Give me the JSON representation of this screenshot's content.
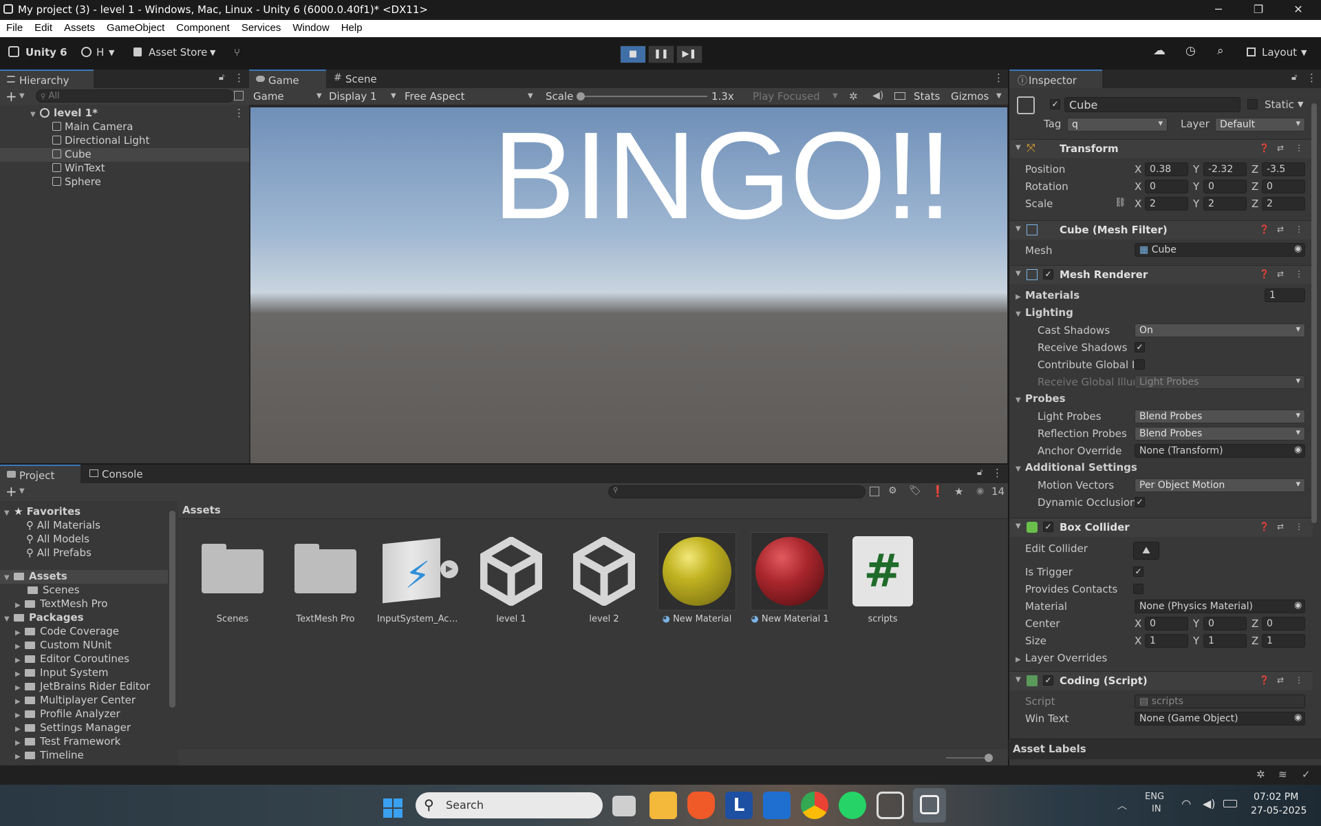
{
  "window": {
    "title": "My project (3) - level 1 - Windows, Mac, Linux - Unity 6 (6000.0.40f1)* <DX11>",
    "minimize": "─",
    "restore": "❐",
    "close": "✕"
  },
  "menu": [
    "File",
    "Edit",
    "Assets",
    "GameObject",
    "Component",
    "Services",
    "Window",
    "Help"
  ],
  "toolbar": {
    "unity_label": "Unity 6",
    "account": "H",
    "asset_store": "Asset Store",
    "layout": "Layout"
  },
  "hierarchy": {
    "tab": "Hierarchy",
    "search_placeholder": "All",
    "scene": "level 1*",
    "items": [
      "Main Camera",
      "Directional Light",
      "Cube",
      "WinText",
      "Sphere"
    ],
    "selected": "Cube"
  },
  "game": {
    "tabs": [
      "Game",
      "Scene"
    ],
    "display_mode": "Game",
    "display": "Display 1",
    "aspect": "Free Aspect",
    "scale_label": "Scale",
    "scale_value": "1.3x",
    "play_focused": "Play Focused",
    "stats": "Stats",
    "gizmos": "Gizmos",
    "overlay_text": "BINGO!!"
  },
  "inspector": {
    "tab": "Inspector",
    "object_name": "Cube",
    "static_label": "Static",
    "tag_label": "Tag",
    "tag_value": "q",
    "layer_label": "Layer",
    "layer_value": "Default",
    "transform": {
      "title": "Transform",
      "position_label": "Position",
      "rotation_label": "Rotation",
      "scale_label": "Scale",
      "position": {
        "x": "0.38",
        "y": "-2.32",
        "z": "-3.5"
      },
      "rotation": {
        "x": "0",
        "y": "0",
        "z": "0"
      },
      "scale": {
        "x": "2",
        "y": "2",
        "z": "2"
      }
    },
    "axis": {
      "x": "X",
      "y": "Y",
      "z": "Z"
    },
    "mesh_filter": {
      "title": "Cube (Mesh Filter)",
      "mesh_label": "Mesh",
      "mesh_value": "Cube"
    },
    "mesh_renderer": {
      "title": "Mesh Renderer",
      "materials_label": "Materials",
      "materials_count": "1",
      "lighting": "Lighting",
      "cast_shadows_label": "Cast Shadows",
      "cast_shadows": "On",
      "receive_shadows_label": "Receive Shadows",
      "contribute_gi_label": "Contribute Global I",
      "receive_gi_label": "Receive Global Illur",
      "receive_gi": "Light Probes",
      "probes": "Probes",
      "light_probes_label": "Light Probes",
      "light_probes": "Blend Probes",
      "reflection_probes_label": "Reflection Probes",
      "reflection_probes": "Blend Probes",
      "anchor_override_label": "Anchor Override",
      "anchor_override": "None (Transform)",
      "additional": "Additional Settings",
      "motion_vectors_label": "Motion Vectors",
      "motion_vectors": "Per Object Motion",
      "dynamic_occlusion_label": "Dynamic Occlusion"
    },
    "box_collider": {
      "title": "Box Collider",
      "edit_label": "Edit Collider",
      "is_trigger_label": "Is Trigger",
      "provides_contacts_label": "Provides Contacts",
      "material_label": "Material",
      "material": "None (Physics Material)",
      "center_label": "Center",
      "size_label": "Size",
      "center": {
        "x": "0",
        "y": "0",
        "z": "0"
      },
      "size": {
        "x": "1",
        "y": "1",
        "z": "1"
      },
      "layer_overrides": "Layer Overrides"
    },
    "script": {
      "title": "Coding (Script)",
      "script_label": "Script",
      "script_value": "scripts",
      "wintext_label": "Win Text",
      "wintext_value": "None (Game Object)"
    },
    "asset_labels": "Asset Labels"
  },
  "project": {
    "tabs": [
      "Project",
      "Console"
    ],
    "count": "14",
    "breadcrumb": "Assets",
    "favorites_label": "Favorites",
    "favorites": [
      "All Materials",
      "All Models",
      "All Prefabs"
    ],
    "assets_label": "Assets",
    "assets_tree": [
      "Scenes",
      "TextMesh Pro"
    ],
    "packages_label": "Packages",
    "packages": [
      "Code Coverage",
      "Custom NUnit",
      "Editor Coroutines",
      "Input System",
      "JetBrains Rider Editor",
      "Multiplayer Center",
      "Profile Analyzer",
      "Settings Manager",
      "Test Framework",
      "Timeline"
    ],
    "assets": [
      "Scenes",
      "TextMesh Pro",
      "InputSystem_Acti...",
      "level 1",
      "level 2",
      "New Material",
      "New Material 1",
      "scripts"
    ]
  },
  "taskbar": {
    "search": "Search",
    "lang1": "ENG",
    "lang2": "IN",
    "time": "07:02 PM",
    "date": "27-05-2025"
  },
  "colors": {
    "accent": "#3a79bb",
    "yellow_material": "#b8a81c",
    "red_material": "#a8262c"
  }
}
